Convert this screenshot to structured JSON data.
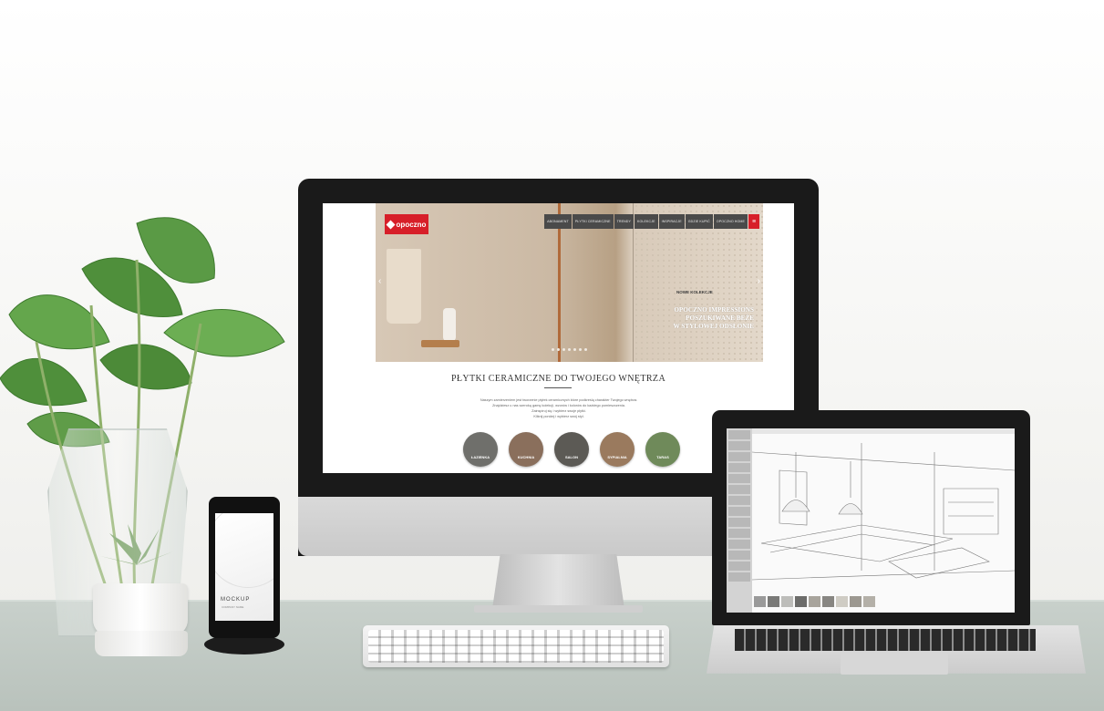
{
  "website": {
    "brand": "opoczno",
    "nav_items": [
      "ABONAMENT",
      "PŁYTKI CERAMICZNE",
      "TRENDY",
      "KOLEKCJE",
      "INSPIRACJE",
      "GDZIE KUPIĆ",
      "OPOCZNO HOME"
    ],
    "hero": {
      "kicker": "NOWE KOLEKCJE",
      "title_lines": [
        "OPOCZNO IMPRESSIONS",
        "POSZUKIWANE BEŻE",
        "W STYLOWEJ ODSŁONIE"
      ]
    },
    "section_title": "PŁYTKI CERAMICZNE DO TWOJEGO WNĘTRZA",
    "paragraph_lines": [
      "Naszym zamierzeniem jest tworzenie płytek ceramicznych które podkreślą charakter Twojego wnętrza.",
      "Znajdziesz u nas szeroką gamę kolekcji, wzorów i kolorów do każdego pomieszczenia.",
      "Zainspiruj się i wybierz swoje płytki.",
      "Kliknij poniżej i wybierz swój styl."
    ],
    "categories": [
      {
        "label": "ŁAZIENKA",
        "color": "#6f6f6b"
      },
      {
        "label": "KUCHNIA",
        "color": "#8a6f5c"
      },
      {
        "label": "SALON",
        "color": "#5c5a55"
      },
      {
        "label": "SYPIALNIA",
        "color": "#9a7a5e"
      },
      {
        "label": "TARAS",
        "color": "#6f8a5a"
      }
    ]
  },
  "phone": {
    "brand": "MOCKUP",
    "tagline": "COMPANY NAME"
  },
  "colors": {
    "brand_red": "#d71f29",
    "nav_dark": "#4a4a4a"
  }
}
